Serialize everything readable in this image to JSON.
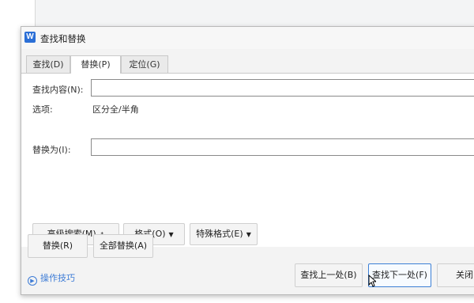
{
  "dialog": {
    "title": "查找和替换",
    "app_icon_text": "W"
  },
  "tabs": [
    {
      "label": "查找(D)",
      "active": false
    },
    {
      "label": "替换(P)",
      "active": true
    },
    {
      "label": "定位(G)",
      "active": false
    }
  ],
  "find": {
    "label": "查找内容(N):",
    "value": ""
  },
  "options": {
    "label": "选项:",
    "value": "区分全/半角"
  },
  "replace": {
    "label": "替换为(I):",
    "value": ""
  },
  "advanced_buttons": {
    "advanced_search": "高级搜索(M)",
    "format": "格式(O)",
    "special_format": "特殊格式(E)"
  },
  "action_buttons": {
    "replace": "替换(R)",
    "replace_all": "全部替换(A)"
  },
  "footer": {
    "help": "操作技巧",
    "find_prev": "查找上一处(B)",
    "find_next": "查找下一处(F)",
    "close": "关闭"
  },
  "colors": {
    "accent": "#3c7bd6",
    "app_icon": "#2b6fd6"
  }
}
